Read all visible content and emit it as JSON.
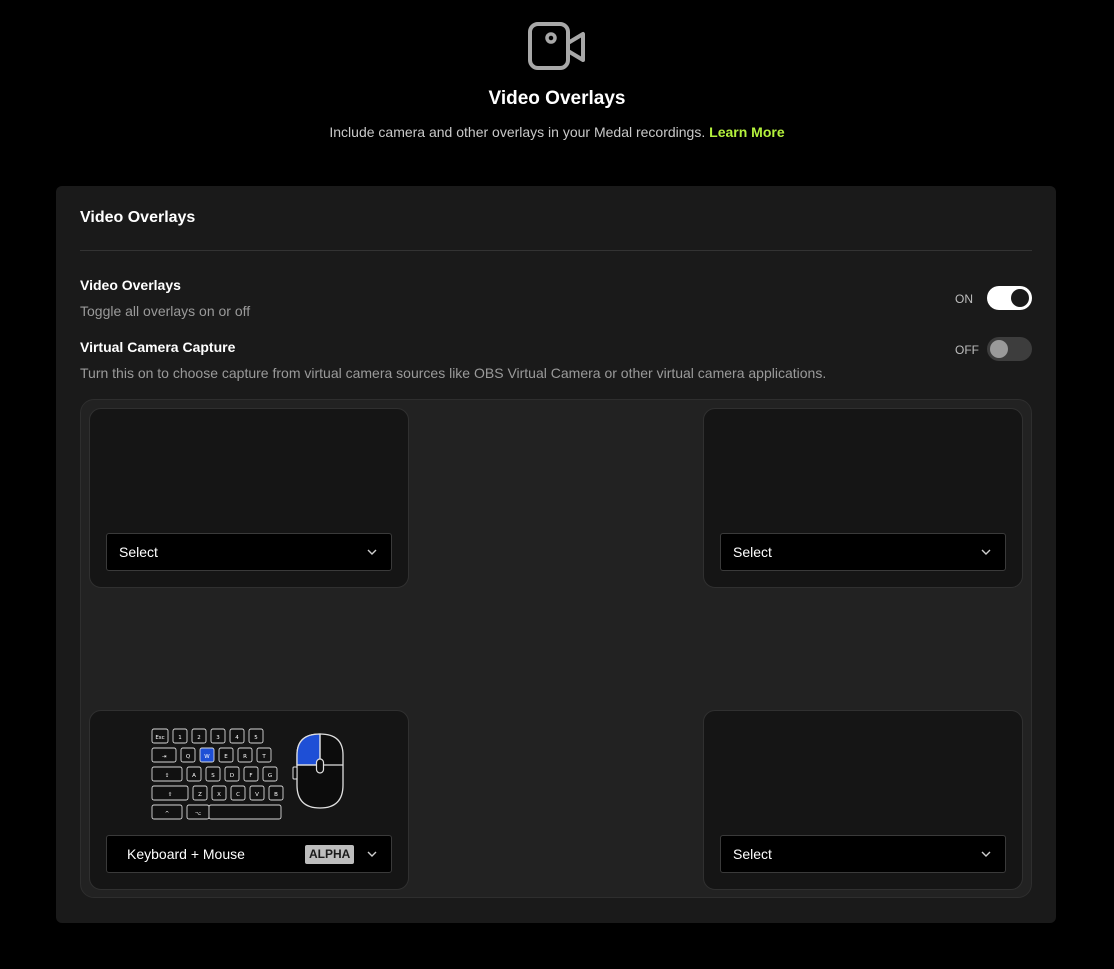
{
  "header": {
    "icon": "video-camera-icon",
    "title": "Video Overlays",
    "subtitle": "Include camera and other overlays in your Medal recordings.",
    "learn_more": "Learn More",
    "accent_color": "#b5f23d"
  },
  "card": {
    "title": "Video Overlays",
    "settings": [
      {
        "title": "Video Overlays",
        "description": "Toggle all overlays on or off",
        "toggle_label": "ON",
        "toggle_on": true
      },
      {
        "title": "Virtual Camera Capture",
        "description": "Turn this on to choose capture from virtual camera sources like OBS Virtual Camera or other virtual camera applications.",
        "toggle_label": "OFF",
        "toggle_on": false
      }
    ],
    "slots": {
      "top_left": {
        "select": "Select"
      },
      "top_right": {
        "select": "Select"
      },
      "bottom_left": {
        "select": "Keyboard + Mouse",
        "badge": "ALPHA",
        "keys": {
          "row1": [
            "Esc",
            "1",
            "2",
            "3",
            "4",
            "5"
          ],
          "row2": [
            "⇥",
            "Q",
            "W",
            "E",
            "R",
            "T"
          ],
          "row3": [
            "⇪",
            "A",
            "S",
            "D",
            "F",
            "G"
          ],
          "row4": [
            "⇧",
            "Z",
            "X",
            "C",
            "V",
            "B"
          ],
          "row5": [
            "^",
            "⌥"
          ]
        },
        "highlight_color": "#1e4fd6"
      },
      "bottom_right": {
        "select": "Select"
      }
    }
  }
}
